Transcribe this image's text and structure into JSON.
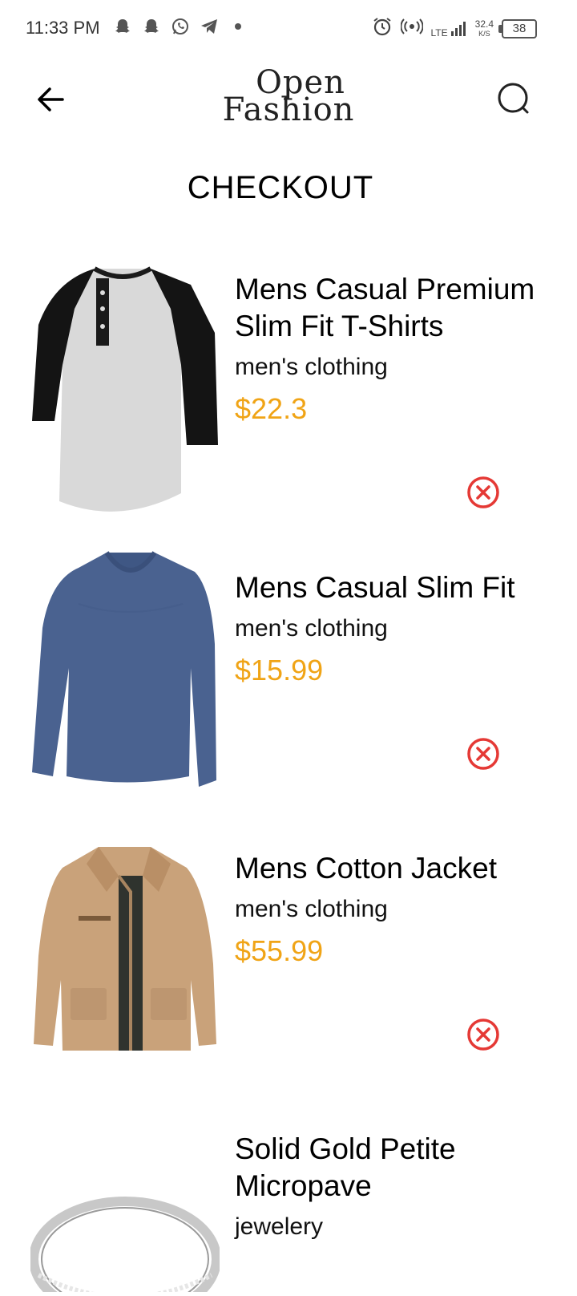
{
  "status_bar": {
    "time": "11:33 PM",
    "lte": "LTE",
    "speed_value": "32.4",
    "speed_unit": "K/S",
    "battery": "38"
  },
  "header": {
    "logo_line1": "Open",
    "logo_line2": "Fashion"
  },
  "page": {
    "title": "CHECKOUT"
  },
  "items": [
    {
      "name": "Mens Casual Premium Slim Fit T-Shirts",
      "category": "men's clothing",
      "price": "$22.3",
      "image": "raglan-henley-shirt"
    },
    {
      "name": "Mens Casual Slim Fit",
      "category": "men's clothing",
      "price": "$15.99",
      "image": "blue-long-sleeve-shirt"
    },
    {
      "name": "Mens Cotton Jacket",
      "category": "men's clothing",
      "price": "$55.99",
      "image": "khaki-cotton-jacket"
    },
    {
      "name": "Solid Gold Petite Micropave",
      "category": "jewelery",
      "price": "",
      "image": "silver-ring"
    }
  ],
  "colors": {
    "price": "#f0a416",
    "remove": "#e53935"
  }
}
